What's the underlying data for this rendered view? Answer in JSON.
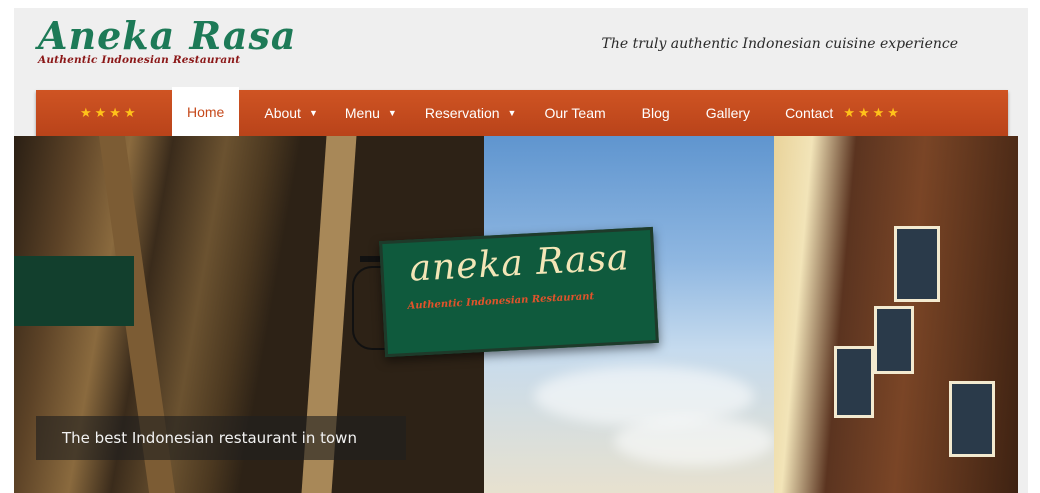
{
  "header": {
    "logo_title": "Aneka Rasa",
    "logo_subtitle": "Authentic Indonesian Restaurant",
    "tagline": "The truly authentic Indonesian cuisine experience"
  },
  "nav": {
    "stars_left": "★★★★",
    "stars_right": "★★★★",
    "items": [
      {
        "label": "Home",
        "active": true,
        "dropdown": false
      },
      {
        "label": "About",
        "active": false,
        "dropdown": true
      },
      {
        "label": "Menu",
        "active": false,
        "dropdown": true
      },
      {
        "label": "Reservation",
        "active": false,
        "dropdown": true
      },
      {
        "label": "Our Team",
        "active": false,
        "dropdown": false
      },
      {
        "label": "Blog",
        "active": false,
        "dropdown": false
      },
      {
        "label": "Gallery",
        "active": false,
        "dropdown": false
      },
      {
        "label": "Contact",
        "active": false,
        "dropdown": false
      }
    ],
    "caret": "▼"
  },
  "hero": {
    "sign_title": "aneka Rasa",
    "sign_subtitle": "Authentic Indonesian Restaurant",
    "caption": "The best Indonesian restaurant in town"
  },
  "colors": {
    "brand_green": "#1d7a57",
    "brand_red": "#8b1717",
    "nav_orange": "#c64a1c",
    "star_gold": "#ffc21a"
  }
}
